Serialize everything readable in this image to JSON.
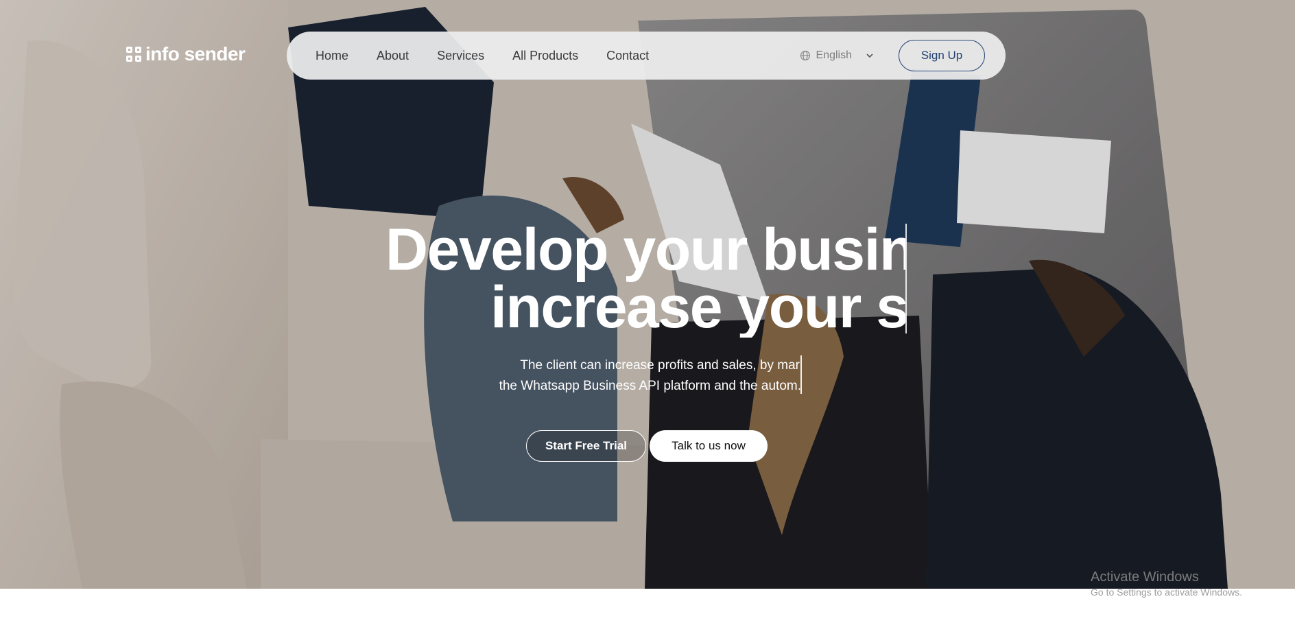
{
  "nav": {
    "logo": "info sender",
    "links": [
      "Home",
      "About",
      "Services",
      "All Products",
      "Contact"
    ],
    "language": "English",
    "signup_label": "Sign Up"
  },
  "hero": {
    "headline": [
      "Develop your busine",
      "increase your sa"
    ],
    "subtext": [
      "The client can increase profits and sales, by mar",
      "the Whatsapp Business API platform and the autom."
    ],
    "primary_cta": "Start Free Trial",
    "secondary_cta": "Talk to us now"
  },
  "watermark": {
    "title": "Activate Windows",
    "subtitle": "Go to Settings to activate Windows."
  },
  "colors": {
    "nav_bg": "#eeeeee",
    "signup_border": "#2a4a7a",
    "text_white": "#ffffff"
  }
}
